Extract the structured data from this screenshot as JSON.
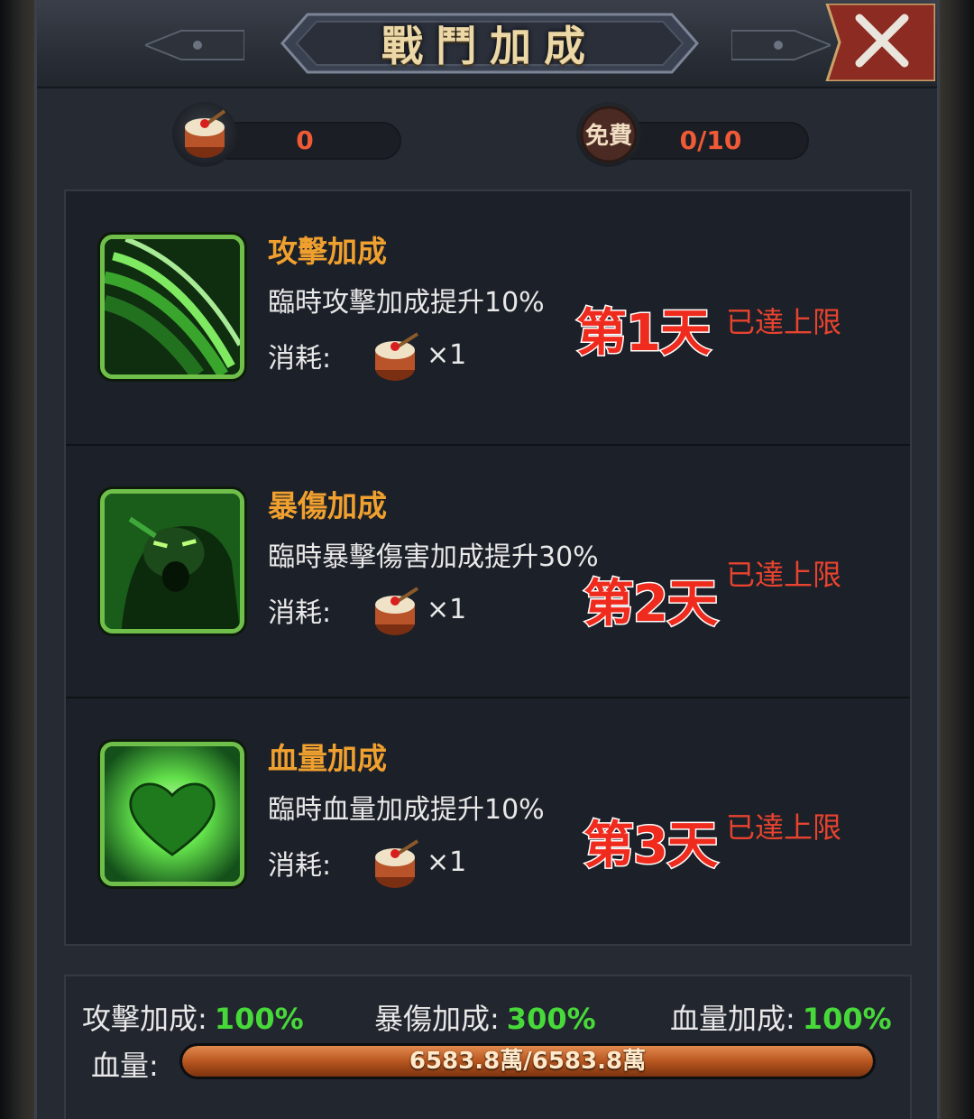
{
  "header": {
    "title": "戰鬥加成"
  },
  "currency": {
    "drum_count": "0",
    "free_label": "免費",
    "free_count": "0/10"
  },
  "skills": [
    {
      "name": "攻擊加成",
      "desc": "臨時攻擊加成提升10%",
      "cost_label": "消耗:",
      "cost_qty": "×1",
      "status": "已達上限",
      "day": "第1天",
      "icon": "green-slash-icon"
    },
    {
      "name": "暴傷加成",
      "desc": "臨時暴擊傷害加成提升30%",
      "cost_label": "消耗:",
      "cost_qty": "×1",
      "status": "已達上限",
      "day": "第2天",
      "icon": "green-roar-icon"
    },
    {
      "name": "血量加成",
      "desc": "臨時血量加成提升10%",
      "cost_label": "消耗:",
      "cost_qty": "×1",
      "status": "已達上限",
      "day": "第3天",
      "icon": "green-heart-icon"
    }
  ],
  "stats": {
    "atk_label": "攻擊加成:",
    "atk_value": "100%",
    "crit_label": "暴傷加成:",
    "crit_value": "300%",
    "hp_bonus_label": "血量加成:",
    "hp_bonus_value": "100%",
    "hp_label": "血量:",
    "hp_text": "6583.8萬/6583.8萬",
    "hp_fraction": 1.0
  },
  "colors": {
    "accent_orange": "#f0a02e",
    "limit_red": "#e8432e",
    "value_green": "#47d83a",
    "icon_green": "#6fbf4a"
  }
}
